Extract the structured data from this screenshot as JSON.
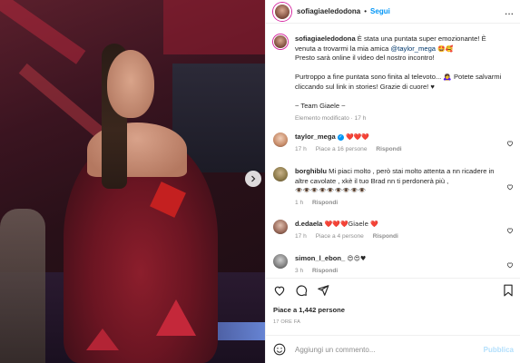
{
  "post": {
    "username": "sofiagiaeledodona",
    "follow_label": "Segui",
    "more_label": "..."
  },
  "caption": {
    "username": "sofiagiaeledodona",
    "text_part1": "È stata una puntata super emozionante! È venuta a trovarmi la mia amica ",
    "mention": "@taylor_mega",
    "emoji1": "🤩🥰",
    "text_part2": "Presto sarà online il video del nostro incontro!",
    "text_part3": "Purtroppo a fine puntata sono finita al televoto... 🙇‍♀️ Potete salvarmi cliccando sul link in stories! Grazie di cuore! ♥",
    "signature": "~ Team Giaele ~",
    "edited": "Elemento modificato · 17 h"
  },
  "comments": [
    {
      "username": "taylor_mega",
      "verified": true,
      "text": "❤️❤️❤️",
      "time": "17 h",
      "likes": "Piace a 16 persone",
      "reply": "Rispondi"
    },
    {
      "username": "borghiblu",
      "text": "Mi piaci molto , però stai molto attenta a nn ricadere in altre cavolate , xkè il tuo Brad nn ti perdonerà più ,",
      "text2": "👁️👁️👁️👁️👁️👁️👁️👁️👁️",
      "time": "1 h",
      "reply": "Rispondi"
    },
    {
      "username": "d.edaela",
      "text": "❤️❤️❤️Giaele ❤️",
      "time": "17 h",
      "likes": "Piace a 4 persone",
      "reply": "Rispondi"
    },
    {
      "username": "simon_l_ebon_",
      "text": "😍😍♥",
      "time": "3 h",
      "reply": "Rispondi"
    }
  ],
  "actions": {
    "likes_label": "Piace a 1,442 persone",
    "time_label": "17 ORE FA"
  },
  "add_comment": {
    "placeholder": "Aggiungi un commento...",
    "publish_label": "Pubblica"
  }
}
